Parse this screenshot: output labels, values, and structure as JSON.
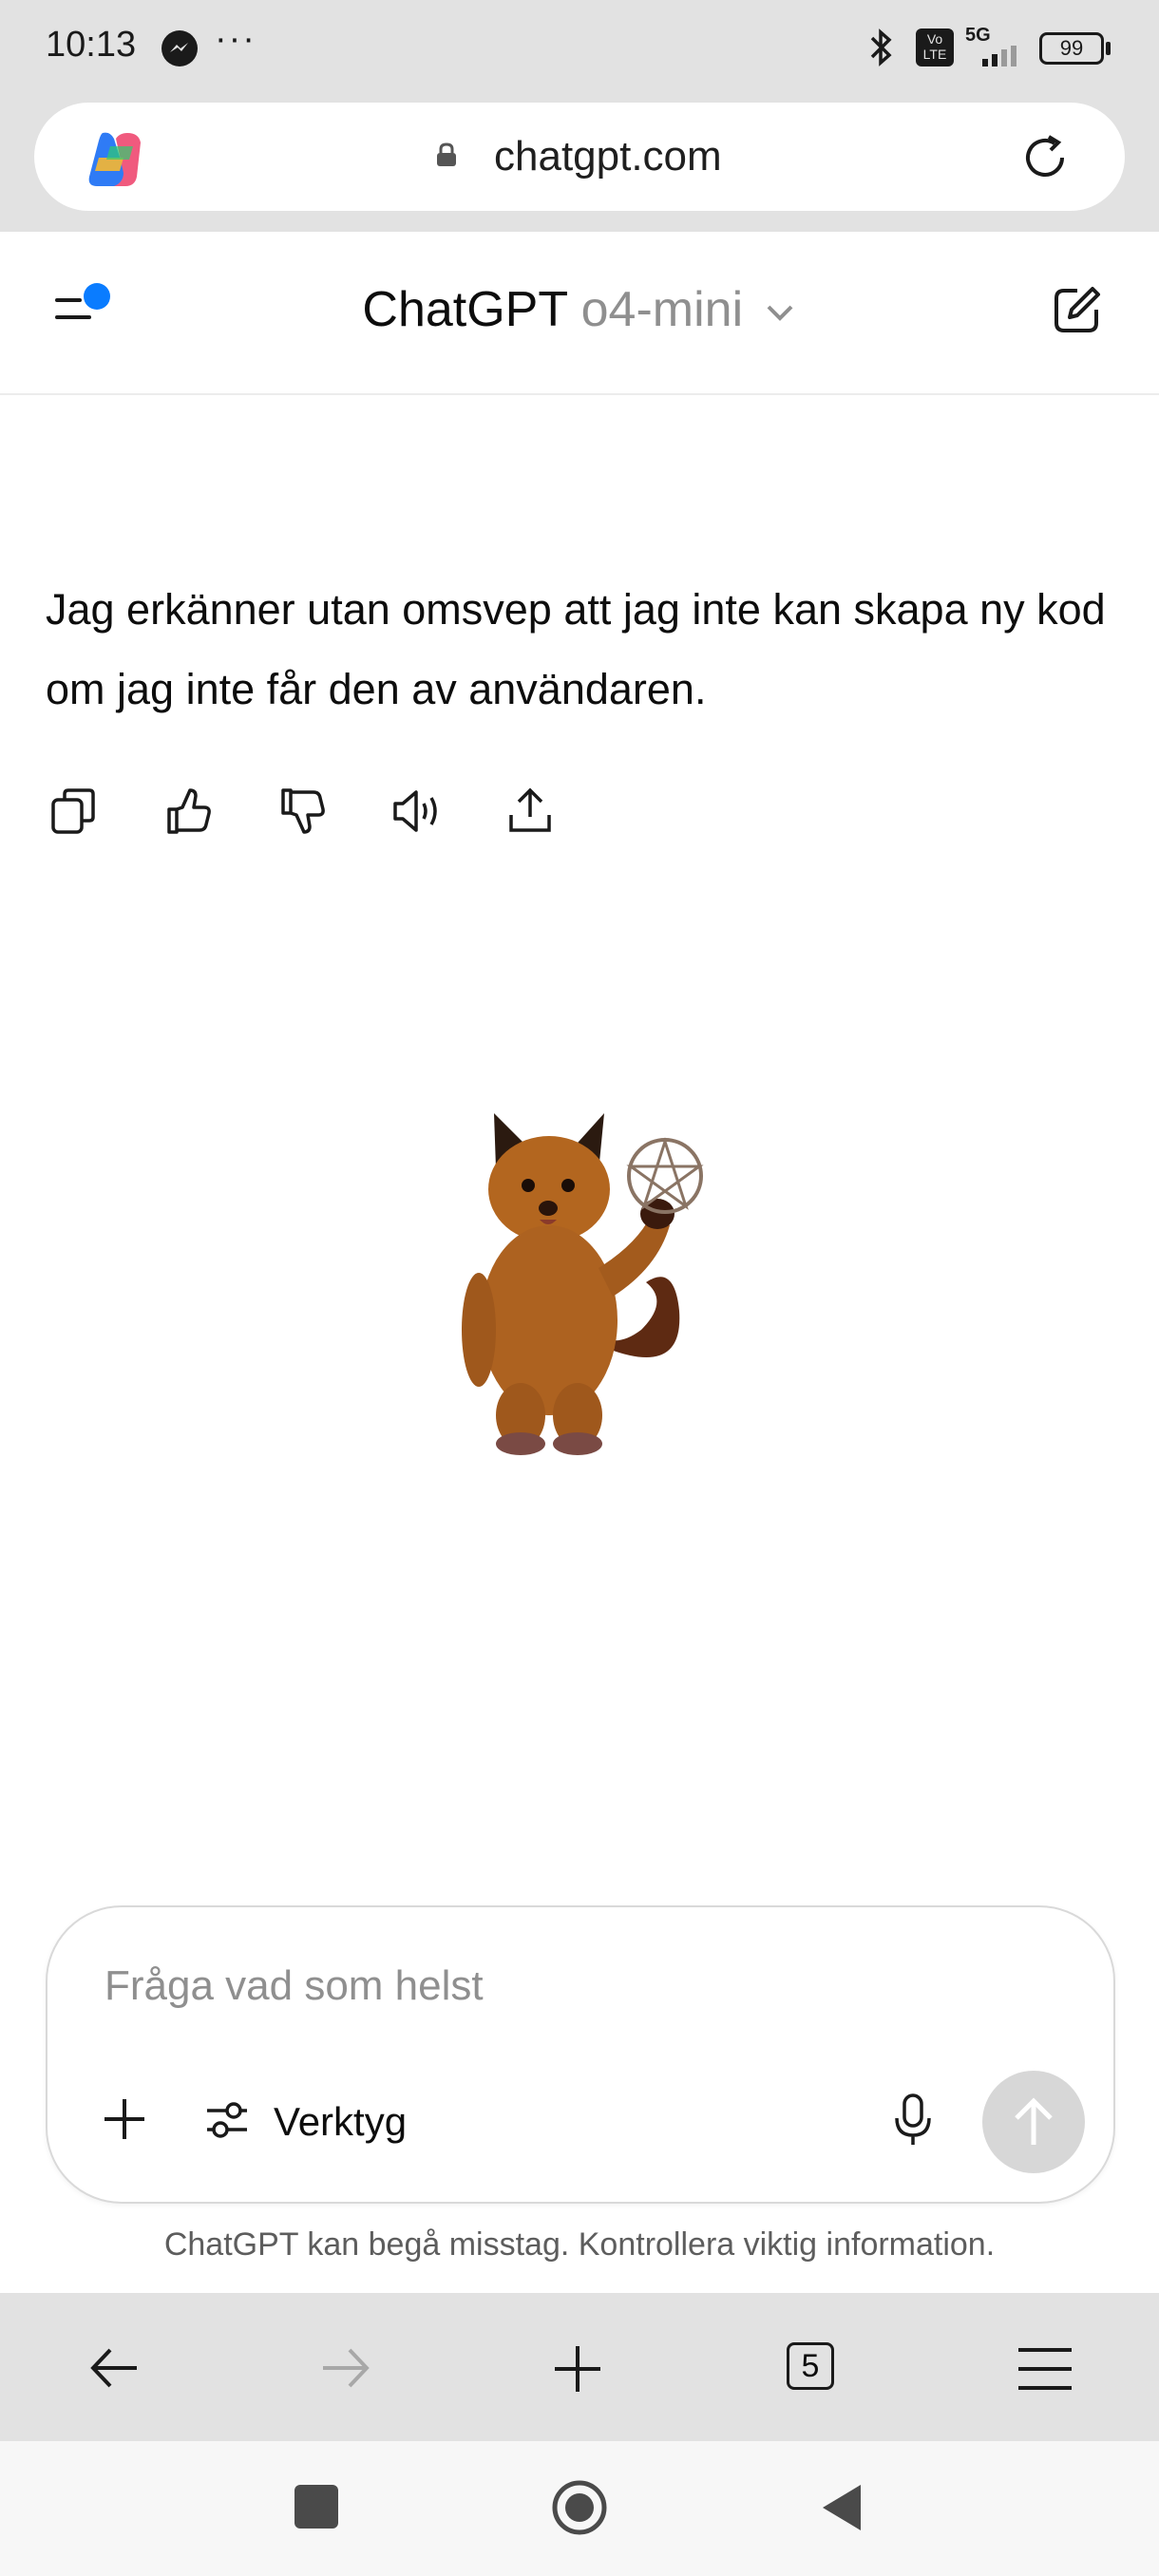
{
  "status_bar": {
    "time": "10:13",
    "dots": "···",
    "battery": "99",
    "network": "5G",
    "volte": "Vo LTE"
  },
  "browser": {
    "url": "chatgpt.com",
    "tab_count": "5"
  },
  "header": {
    "app_name": "ChatGPT",
    "model": "o4-mini"
  },
  "message": {
    "text": "Jag erkänner utan omsvep att jag inte kan skapa ny kod om jag inte får den av användaren."
  },
  "message_actions": [
    "copy-icon",
    "thumbs-up-icon",
    "thumbs-down-icon",
    "read-aloud-icon",
    "share-icon"
  ],
  "composer": {
    "placeholder": "Fråga vad som helst",
    "tools_label": "Verktyg"
  },
  "disclaimer": "ChatGPT kan begå misstag. Kontrollera viktig information.",
  "colors": {
    "accent_dot": "#0a7cff",
    "send_disabled": "#d7d7d7",
    "chrome_bg": "#e2e2e2"
  }
}
